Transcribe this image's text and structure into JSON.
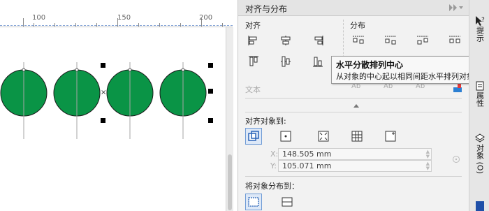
{
  "ruler": {
    "labels": [
      "100",
      "150",
      "200"
    ]
  },
  "panel": {
    "title": "对齐与分布",
    "align_label": "对齐",
    "distribute_label": "分布",
    "text_label": "文本",
    "align_to_label": "对齐对象到:",
    "coord_x_label": "X:",
    "coord_x": "148.505 mm",
    "coord_y_label": "Y:",
    "coord_y": "105.071 mm",
    "distribute_to_label": "将对象分布到：",
    "text_glyphs": [
      "Ȧb",
      "Ȧb",
      "Ȧb",
      "A"
    ]
  },
  "tooltip": {
    "title": "水平分散排列中心",
    "description": "从对象的中心起以相同间距水平排列对象。"
  },
  "side_tabs": {
    "hints_label": "提示",
    "properties_label": "属性",
    "objects_label": "对象 (O)"
  },
  "colors": {
    "circle_fill": "#0a9446",
    "accent": "#3a6fc4",
    "tooltip_bg": "#f8f8f8"
  }
}
